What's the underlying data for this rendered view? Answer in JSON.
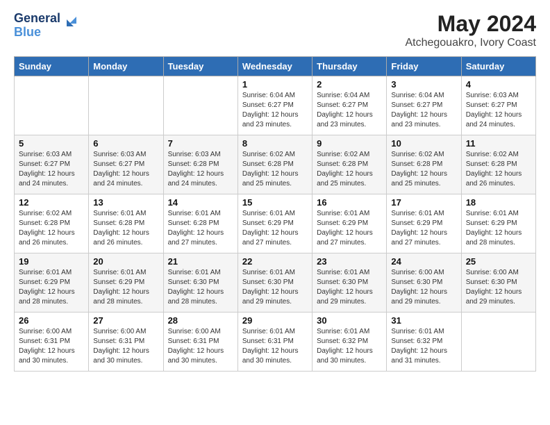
{
  "header": {
    "logo_line1": "General",
    "logo_line2": "Blue",
    "month_year": "May 2024",
    "location": "Atchegouakro, Ivory Coast"
  },
  "weekdays": [
    "Sunday",
    "Monday",
    "Tuesday",
    "Wednesday",
    "Thursday",
    "Friday",
    "Saturday"
  ],
  "weeks": [
    [
      {
        "day": "",
        "info": ""
      },
      {
        "day": "",
        "info": ""
      },
      {
        "day": "",
        "info": ""
      },
      {
        "day": "1",
        "info": "Sunrise: 6:04 AM\nSunset: 6:27 PM\nDaylight: 12 hours\nand 23 minutes."
      },
      {
        "day": "2",
        "info": "Sunrise: 6:04 AM\nSunset: 6:27 PM\nDaylight: 12 hours\nand 23 minutes."
      },
      {
        "day": "3",
        "info": "Sunrise: 6:04 AM\nSunset: 6:27 PM\nDaylight: 12 hours\nand 23 minutes."
      },
      {
        "day": "4",
        "info": "Sunrise: 6:03 AM\nSunset: 6:27 PM\nDaylight: 12 hours\nand 24 minutes."
      }
    ],
    [
      {
        "day": "5",
        "info": "Sunrise: 6:03 AM\nSunset: 6:27 PM\nDaylight: 12 hours\nand 24 minutes."
      },
      {
        "day": "6",
        "info": "Sunrise: 6:03 AM\nSunset: 6:27 PM\nDaylight: 12 hours\nand 24 minutes."
      },
      {
        "day": "7",
        "info": "Sunrise: 6:03 AM\nSunset: 6:28 PM\nDaylight: 12 hours\nand 24 minutes."
      },
      {
        "day": "8",
        "info": "Sunrise: 6:02 AM\nSunset: 6:28 PM\nDaylight: 12 hours\nand 25 minutes."
      },
      {
        "day": "9",
        "info": "Sunrise: 6:02 AM\nSunset: 6:28 PM\nDaylight: 12 hours\nand 25 minutes."
      },
      {
        "day": "10",
        "info": "Sunrise: 6:02 AM\nSunset: 6:28 PM\nDaylight: 12 hours\nand 25 minutes."
      },
      {
        "day": "11",
        "info": "Sunrise: 6:02 AM\nSunset: 6:28 PM\nDaylight: 12 hours\nand 26 minutes."
      }
    ],
    [
      {
        "day": "12",
        "info": "Sunrise: 6:02 AM\nSunset: 6:28 PM\nDaylight: 12 hours\nand 26 minutes."
      },
      {
        "day": "13",
        "info": "Sunrise: 6:01 AM\nSunset: 6:28 PM\nDaylight: 12 hours\nand 26 minutes."
      },
      {
        "day": "14",
        "info": "Sunrise: 6:01 AM\nSunset: 6:28 PM\nDaylight: 12 hours\nand 27 minutes."
      },
      {
        "day": "15",
        "info": "Sunrise: 6:01 AM\nSunset: 6:29 PM\nDaylight: 12 hours\nand 27 minutes."
      },
      {
        "day": "16",
        "info": "Sunrise: 6:01 AM\nSunset: 6:29 PM\nDaylight: 12 hours\nand 27 minutes."
      },
      {
        "day": "17",
        "info": "Sunrise: 6:01 AM\nSunset: 6:29 PM\nDaylight: 12 hours\nand 27 minutes."
      },
      {
        "day": "18",
        "info": "Sunrise: 6:01 AM\nSunset: 6:29 PM\nDaylight: 12 hours\nand 28 minutes."
      }
    ],
    [
      {
        "day": "19",
        "info": "Sunrise: 6:01 AM\nSunset: 6:29 PM\nDaylight: 12 hours\nand 28 minutes."
      },
      {
        "day": "20",
        "info": "Sunrise: 6:01 AM\nSunset: 6:29 PM\nDaylight: 12 hours\nand 28 minutes."
      },
      {
        "day": "21",
        "info": "Sunrise: 6:01 AM\nSunset: 6:30 PM\nDaylight: 12 hours\nand 28 minutes."
      },
      {
        "day": "22",
        "info": "Sunrise: 6:01 AM\nSunset: 6:30 PM\nDaylight: 12 hours\nand 29 minutes."
      },
      {
        "day": "23",
        "info": "Sunrise: 6:01 AM\nSunset: 6:30 PM\nDaylight: 12 hours\nand 29 minutes."
      },
      {
        "day": "24",
        "info": "Sunrise: 6:00 AM\nSunset: 6:30 PM\nDaylight: 12 hours\nand 29 minutes."
      },
      {
        "day": "25",
        "info": "Sunrise: 6:00 AM\nSunset: 6:30 PM\nDaylight: 12 hours\nand 29 minutes."
      }
    ],
    [
      {
        "day": "26",
        "info": "Sunrise: 6:00 AM\nSunset: 6:31 PM\nDaylight: 12 hours\nand 30 minutes."
      },
      {
        "day": "27",
        "info": "Sunrise: 6:00 AM\nSunset: 6:31 PM\nDaylight: 12 hours\nand 30 minutes."
      },
      {
        "day": "28",
        "info": "Sunrise: 6:00 AM\nSunset: 6:31 PM\nDaylight: 12 hours\nand 30 minutes."
      },
      {
        "day": "29",
        "info": "Sunrise: 6:01 AM\nSunset: 6:31 PM\nDaylight: 12 hours\nand 30 minutes."
      },
      {
        "day": "30",
        "info": "Sunrise: 6:01 AM\nSunset: 6:32 PM\nDaylight: 12 hours\nand 30 minutes."
      },
      {
        "day": "31",
        "info": "Sunrise: 6:01 AM\nSunset: 6:32 PM\nDaylight: 12 hours\nand 31 minutes."
      },
      {
        "day": "",
        "info": ""
      }
    ]
  ]
}
